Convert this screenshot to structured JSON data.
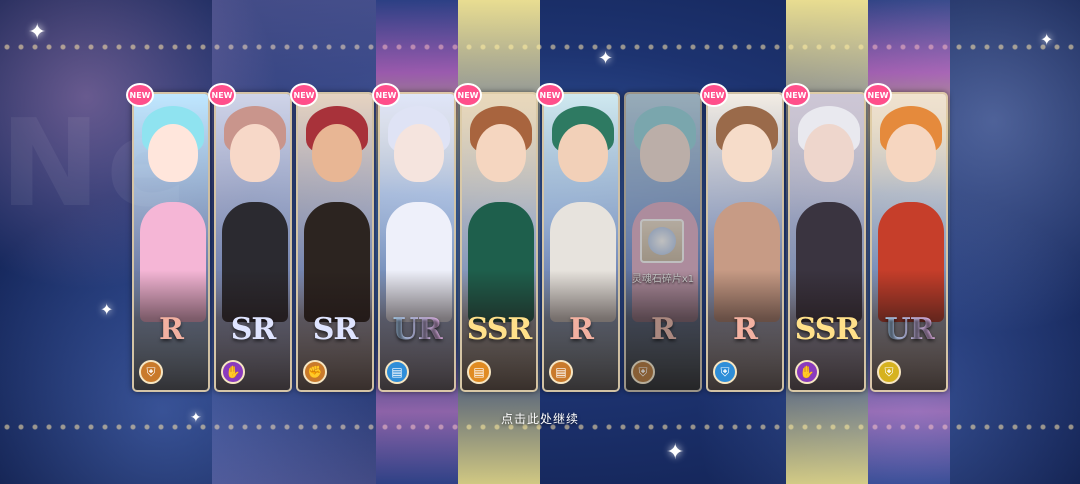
{
  "background": {
    "sign_text": "Ne"
  },
  "cards": [
    {
      "rarity": "R",
      "rarity_class": "r",
      "is_new": true,
      "role_icon": "shield-icon",
      "role_color": "#c97a2b",
      "hair": "#8fe3f0",
      "skin": "#ffe6dc",
      "outfit": "#f5b6d6",
      "bg": "#bfe7ff"
    },
    {
      "rarity": "SR",
      "rarity_class": "sr",
      "is_new": true,
      "role_icon": "hand-icon",
      "role_color": "#8a3bbd",
      "hair": "#c9958c",
      "skin": "#f7d8c8",
      "outfit": "#2b2a30",
      "bg": "#cfd4e8"
    },
    {
      "rarity": "SR",
      "rarity_class": "sr",
      "is_new": true,
      "role_icon": "fist-icon",
      "role_color": "#c97a2b",
      "hair": "#a8323a",
      "skin": "#e8b694",
      "outfit": "#2c2420",
      "bg": "#e6d3c1"
    },
    {
      "rarity": "UR",
      "rarity_class": "ur",
      "is_new": true,
      "role_icon": "book-icon",
      "role_color": "#2f8ed8",
      "hair": "#dfe3f5",
      "skin": "#f5e4de",
      "outfit": "#eef0fa",
      "bg": "#dfe6f8"
    },
    {
      "rarity": "SSR",
      "rarity_class": "ssr",
      "is_new": true,
      "role_icon": "book-icon",
      "role_color": "#e08b22",
      "hair": "#a8643e",
      "skin": "#f5d6c0",
      "outfit": "#1e5f4c",
      "bg": "#e9d8bb"
    },
    {
      "rarity": "R",
      "rarity_class": "r",
      "is_new": true,
      "role_icon": "book-icon",
      "role_color": "#c97a2b",
      "hair": "#2e7a62",
      "skin": "#f2d0b8",
      "outfit": "#e7e3dd",
      "bg": "#cfe9f0"
    },
    {
      "rarity": "R",
      "rarity_class": "r",
      "is_new": false,
      "role_icon": "shield-icon",
      "role_color": "#c97a2b",
      "hair": "#8fe3f0",
      "skin": "#ffe6dc",
      "outfit": "#f5b6d6",
      "bg": "#bfe7ff",
      "duplicate": true,
      "duplicate_label": "灵魂石碎片x1"
    },
    {
      "rarity": "R",
      "rarity_class": "r",
      "is_new": true,
      "role_icon": "shield-icon",
      "role_color": "#2f8ed8",
      "hair": "#9a6a4a",
      "skin": "#f6dcc9",
      "outfit": "#c79b85",
      "bg": "#f3ede4"
    },
    {
      "rarity": "SSR",
      "rarity_class": "ssr",
      "is_new": true,
      "role_icon": "hand-icon",
      "role_color": "#8a3bbd",
      "hair": "#e9e9ef",
      "skin": "#eed6cc",
      "outfit": "#3a3440",
      "bg": "#cdc6d6"
    },
    {
      "rarity": "UR",
      "rarity_class": "ur",
      "is_new": true,
      "role_icon": "shield-icon",
      "role_color": "#d6b21f",
      "hair": "#e58a3c",
      "skin": "#f6d6c0",
      "outfit": "#c63e2a",
      "bg": "#f0e3cf"
    }
  ],
  "new_badge_label": "NEW",
  "continue_hint": "点击此处继续",
  "colors": {
    "new_badge": "#ff4f8b",
    "card_border": "#e6d2aa"
  }
}
